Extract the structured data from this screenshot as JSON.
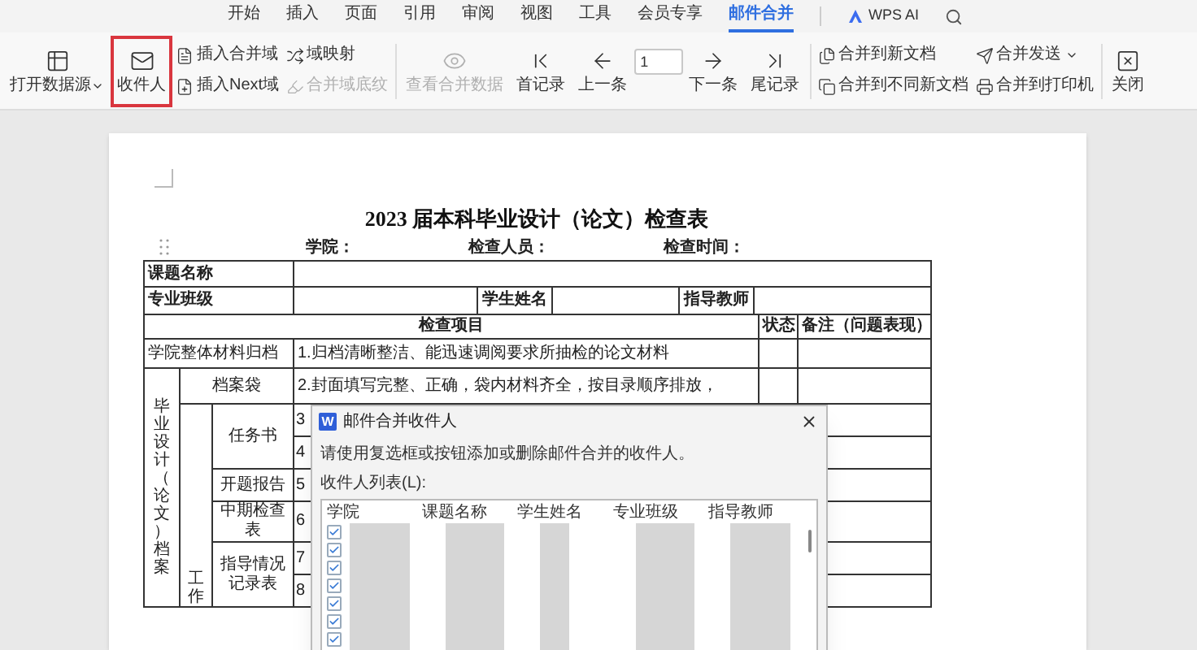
{
  "menu_tabs": [
    {
      "label": "开始",
      "selected": false
    },
    {
      "label": "插入",
      "selected": false
    },
    {
      "label": "页面",
      "selected": false
    },
    {
      "label": "引用",
      "selected": false
    },
    {
      "label": "审阅",
      "selected": false
    },
    {
      "label": "视图",
      "selected": false
    },
    {
      "label": "工具",
      "selected": false
    },
    {
      "label": "会员专享",
      "selected": false
    },
    {
      "label": "邮件合并",
      "selected": true
    }
  ],
  "ai_button": "WPS AI",
  "ribbon": [
    [
      {
        "kind": "large",
        "label": "打开数据源",
        "dropdown": true,
        "disabled": false,
        "highlighted": false
      },
      {
        "kind": "large",
        "label": "收件人",
        "dropdown": false,
        "disabled": false,
        "highlighted": true
      },
      {
        "kind": "stack",
        "items": [
          {
            "label": "插入合并域",
            "disabled": false,
            "dropdown": false
          },
          {
            "label": "插入Next域",
            "disabled": false,
            "dropdown": false
          }
        ]
      },
      {
        "kind": "stack",
        "items": [
          {
            "label": "域映射",
            "disabled": false,
            "dropdown": false
          },
          {
            "label": "合并域底纹",
            "disabled": true,
            "dropdown": false
          }
        ]
      }
    ],
    [
      {
        "kind": "large",
        "label": "查看合并数据",
        "dropdown": false,
        "disabled": true,
        "highlighted": false
      },
      {
        "kind": "large",
        "label": "首记录",
        "dropdown": false,
        "disabled": false,
        "highlighted": false
      },
      {
        "kind": "large",
        "label": "上一条",
        "dropdown": false,
        "disabled": false,
        "highlighted": false
      },
      {
        "kind": "input",
        "value": "1"
      },
      {
        "kind": "large",
        "label": "下一条",
        "dropdown": false,
        "disabled": false,
        "highlighted": false
      },
      {
        "kind": "large",
        "label": "尾记录",
        "dropdown": false,
        "disabled": false,
        "highlighted": false
      }
    ],
    [
      {
        "kind": "stack",
        "items": [
          {
            "label": "合并到新文档",
            "disabled": false,
            "dropdown": false
          },
          {
            "label": "合并到不同新文档",
            "disabled": false,
            "dropdown": false
          }
        ]
      },
      {
        "kind": "stack",
        "items": [
          {
            "label": "合并发送",
            "disabled": false,
            "dropdown": true
          },
          {
            "label": "合并到打印机",
            "disabled": false,
            "dropdown": false
          }
        ]
      }
    ],
    [
      {
        "kind": "large",
        "label": "关闭",
        "dropdown": false,
        "disabled": false,
        "highlighted": false
      }
    ]
  ],
  "document": {
    "title": "2023 届本科毕业设计（论文）检查表",
    "header_fields": [
      "学院：",
      "检查人员：",
      "检查时间："
    ],
    "info_rows": [
      [
        "课题名称"
      ],
      [
        "专业班级",
        "学生姓名",
        "指导教师"
      ]
    ],
    "columns": [
      "检查项目",
      "状态",
      "备注（问题表现）"
    ],
    "archive_row": {
      "label": "学院整体材料归档",
      "text": "1.归档清晰整洁、能迅速调阅要求所抽检的论文材料"
    },
    "bag_row": {
      "label": "档案袋",
      "text": "2.封面填写完整、正确，袋内材料齐全，按目录顺序排放，"
    },
    "section_label": "毕业设计（论文）档案",
    "subsection_label": "工作",
    "groups": [
      {
        "label": "任务书",
        "items": [
          "3",
          "4"
        ]
      },
      {
        "label": "开题报告",
        "items": [
          "5"
        ]
      },
      {
        "label": "中期检查表",
        "items": [
          "6"
        ]
      },
      {
        "label": "指导情况记录表",
        "items": [
          "7",
          "8"
        ]
      }
    ]
  },
  "dialog": {
    "app_badge": "W",
    "title": "邮件合并收件人",
    "instruction": "请使用复选框或按钮添加或删除邮件合并的收件人。",
    "list_label": "收件人列表(L):",
    "columns": [
      "学院",
      "课题名称",
      "学生姓名",
      "专业班级",
      "指导教师"
    ],
    "rows": [
      {
        "checked": true
      },
      {
        "checked": true
      },
      {
        "checked": true
      },
      {
        "checked": true
      },
      {
        "checked": true
      },
      {
        "checked": true
      },
      {
        "checked": true
      }
    ]
  }
}
